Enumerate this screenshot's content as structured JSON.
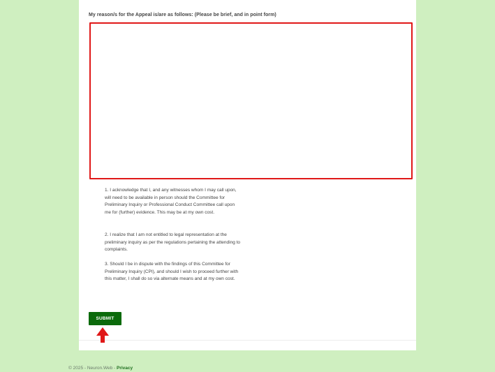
{
  "form": {
    "reason_label": "My reason/s for the Appeal is/are as follows: (Please be brief, and in point form)",
    "reason_value": "",
    "acknowledgements": [
      "1. I acknowledge that I, and any witnesses whom I may call upon, will need to be available in person should the Committee for Preliminary Inquiry or Professional Conduct Committee call upon me for (further) evidence. This may be at my own cost.",
      "2. I realize that I am not entitled to legal representation at the preliminary inquiry as per the regulations pertaining the attending to complaints.",
      "3. Should I be in dispute with the findings of this Committee for Preliminary Inquiry (CPI), and should I wish to proceed further with this matter, I shall do so via alternate means and at my own cost."
    ],
    "submit_label": "SUBMIT"
  },
  "footer": {
    "copyright": "© 2025 - Neuron.Web - ",
    "privacy_label": "Privacy"
  },
  "annotation": {
    "arrow_icon": "up-arrow-icon",
    "arrow_color": "#e01818"
  },
  "colors": {
    "page_background": "#cfefc0",
    "panel_background": "#ffffff",
    "textarea_border": "#e01818",
    "submit_background": "#0b6a0b",
    "privacy_link": "#1f6f1f"
  }
}
